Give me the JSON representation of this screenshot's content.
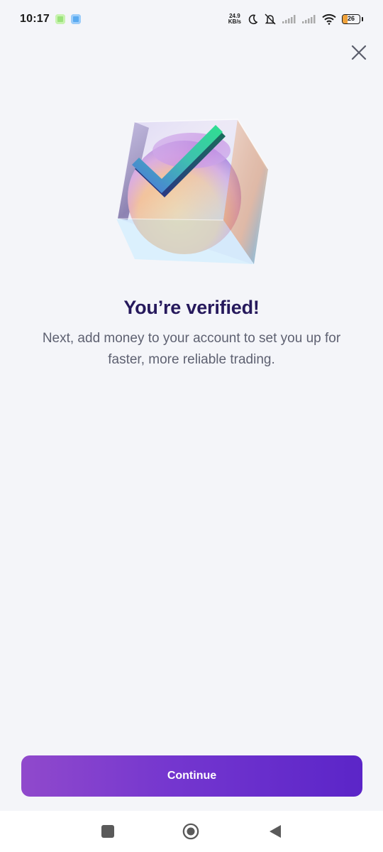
{
  "status_bar": {
    "time": "10:17",
    "net_speed_value": "24.9",
    "net_speed_unit": "KB/s",
    "battery_level": "26"
  },
  "icons": {
    "close": "close-icon",
    "hero": "verified-cube-illustration",
    "nav_recents": "square-icon",
    "nav_home": "circle-icon",
    "nav_back": "back-triangle-icon"
  },
  "content": {
    "title": "You’re verified!",
    "subtitle": "Next, add money to your account to set you up for faster, more reliable trading."
  },
  "actions": {
    "continue_label": "Continue"
  },
  "colors": {
    "background": "#f4f5f9",
    "title": "#26195c",
    "subtitle": "#5e6171",
    "button_start": "#9049cc",
    "button_end": "#5b25c8"
  }
}
